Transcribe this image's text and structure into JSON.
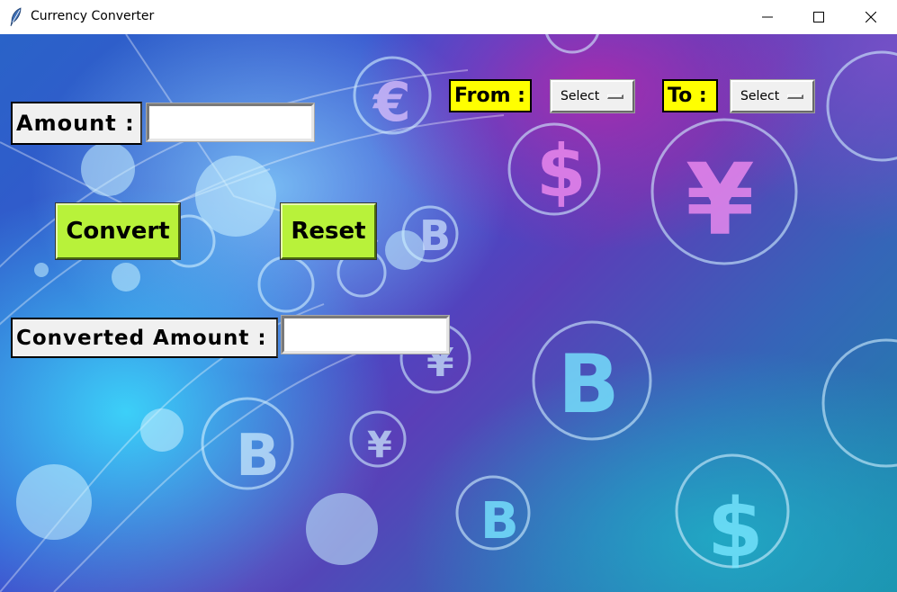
{
  "window": {
    "title": "Currency Converter",
    "icon": "feather-icon",
    "controls": [
      "minimize-icon",
      "maximize-icon",
      "close-icon"
    ]
  },
  "form": {
    "amount_label": "Amount :",
    "amount_value": "",
    "from_label": "From :",
    "from_selected": "Select",
    "to_label": "To :",
    "to_selected": "Select",
    "convert_label": "Convert",
    "reset_label": "Reset",
    "converted_label": "Converted Amount :",
    "converted_value": ""
  },
  "colors": {
    "button_bg": "#b8f23a",
    "from_to_label_bg": "#ffff00",
    "label_bg": "#f0f0f0"
  }
}
